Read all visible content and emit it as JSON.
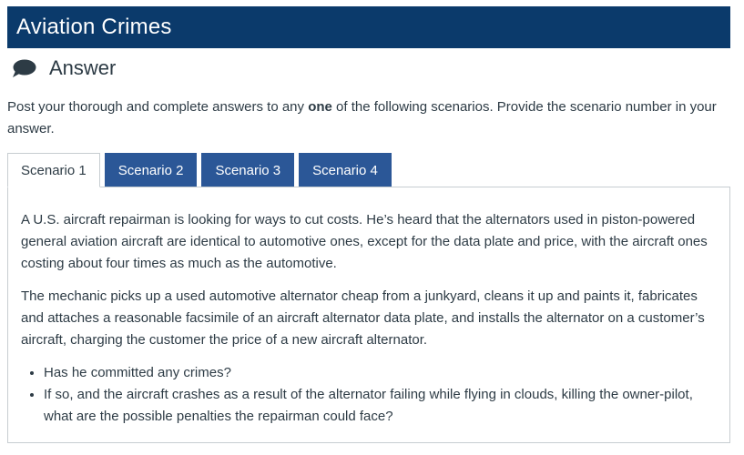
{
  "header": {
    "title": "Aviation Crimes"
  },
  "section": {
    "icon": "speech-bubble-icon",
    "title": "Answer"
  },
  "intro": {
    "before": "Post your thorough and complete answers to any ",
    "emphasis": "one",
    "after": " of the following scenarios. Provide the scenario number in your answer."
  },
  "tabs": [
    {
      "label": "Scenario 1",
      "active": true
    },
    {
      "label": "Scenario 2",
      "active": false
    },
    {
      "label": "Scenario 3",
      "active": false
    },
    {
      "label": "Scenario 4",
      "active": false
    }
  ],
  "panel": {
    "paragraphs": [
      "A U.S. aircraft repairman is looking for ways to cut costs. He’s heard that the alternators used in piston-powered general aviation aircraft are identical to automotive ones, except for the data plate and price, with the aircraft ones costing about four times as much as the automotive.",
      "The mechanic picks up a used automotive alternator cheap from a junkyard, cleans it up and paints it, fabricates and attaches a reasonable facsimile of an aircraft alternator data plate, and installs the alternator on a customer’s aircraft, charging the customer the price of a new aircraft alternator."
    ],
    "bullets": [
      "Has he committed any crimes?",
      "If so, and the aircraft crashes as a result of the alternator failing while flying in clouds, killing the owner-pilot, what are the possible penalties the repairman could face?"
    ]
  },
  "colors": {
    "banner": "#0b3a6b",
    "tab_inactive": "#2b5797",
    "text": "#2d3b45",
    "border": "#c7cdd1"
  }
}
